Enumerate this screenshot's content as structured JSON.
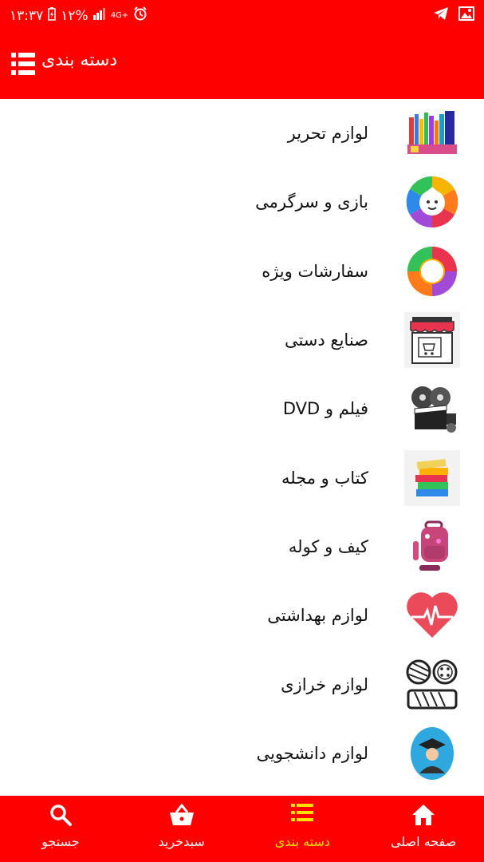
{
  "status_bar": {
    "time": "۱۳:۳۷",
    "battery": "۱۲%",
    "network": "4G+"
  },
  "app_bar": {
    "title": "دسته بندی"
  },
  "categories": [
    {
      "label": "لوازم تحریر",
      "icon": "stationery-icon"
    },
    {
      "label": "بازی و سرگرمی",
      "icon": "game-icon"
    },
    {
      "label": "سفارشات ویژه",
      "icon": "special-order-icon"
    },
    {
      "label": "صنایع دستی",
      "icon": "handicraft-shop-icon"
    },
    {
      "label": "فیلم و DVD",
      "icon": "film-reel-icon"
    },
    {
      "label": "کتاب و مجله",
      "icon": "books-icon"
    },
    {
      "label": "کیف و کوله",
      "icon": "backpack-icon"
    },
    {
      "label": "لوازم بهداشتی",
      "icon": "heart-pulse-icon"
    },
    {
      "label": "لوازم خرازی",
      "icon": "yarn-button-icon"
    },
    {
      "label": "لوازم دانشجویی",
      "icon": "graduate-icon"
    }
  ],
  "bottom_nav": {
    "items": [
      {
        "label": "جستجو",
        "icon": "search-icon"
      },
      {
        "label": "سبدخرید",
        "icon": "basket-icon"
      },
      {
        "label": "دسته بندی",
        "icon": "list-icon"
      },
      {
        "label": "صفحه اصلی",
        "icon": "home-icon"
      }
    ],
    "active": "دسته بندی"
  },
  "colors": {
    "primary": "#ff0000",
    "active_nav": "#ffe000",
    "text": "#111111"
  }
}
